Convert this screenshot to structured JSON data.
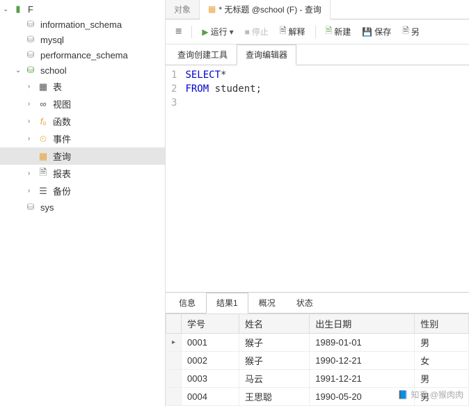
{
  "sidebar": {
    "root": "F",
    "databases": [
      {
        "name": "information_schema",
        "expanded": false
      },
      {
        "name": "mysql",
        "expanded": false
      },
      {
        "name": "performance_schema",
        "expanded": false
      },
      {
        "name": "school",
        "expanded": true
      },
      {
        "name": "sys",
        "expanded": false
      }
    ],
    "school_children": [
      {
        "label": "表",
        "icon": "table"
      },
      {
        "label": "视图",
        "icon": "view"
      },
      {
        "label": "函数",
        "icon": "function"
      },
      {
        "label": "事件",
        "icon": "event"
      },
      {
        "label": "查询",
        "icon": "query",
        "selected": true
      },
      {
        "label": "报表",
        "icon": "report"
      },
      {
        "label": "备份",
        "icon": "backup"
      }
    ]
  },
  "file_tabs": {
    "inactive": "对象",
    "active": "* 无标题 @school (F) - 查询"
  },
  "toolbar": {
    "run": "运行",
    "stop": "停止",
    "explain": "解释",
    "new": "新建",
    "save": "保存",
    "other": "另"
  },
  "query_tabs": {
    "builder": "查询创建工具",
    "editor": "查询编辑器"
  },
  "sql": {
    "lines": [
      "1",
      "2",
      "3"
    ],
    "kw1": "SELECT",
    "star": "*",
    "kw2": "FROM",
    "tbl": "student;"
  },
  "result_tabs": {
    "info": "信息",
    "result1": "结果1",
    "profile": "概况",
    "status": "状态"
  },
  "table": {
    "headers": [
      "学号",
      "姓名",
      "出生日期",
      "性别"
    ],
    "rows": [
      [
        "0001",
        "猴子",
        "1989-01-01",
        "男"
      ],
      [
        "0002",
        "猴子",
        "1990-12-21",
        "女"
      ],
      [
        "0003",
        "马云",
        "1991-12-21",
        "男"
      ],
      [
        "0004",
        "王思聪",
        "1990-05-20",
        "男"
      ]
    ]
  },
  "watermark": "知乎 @猴肉肉"
}
